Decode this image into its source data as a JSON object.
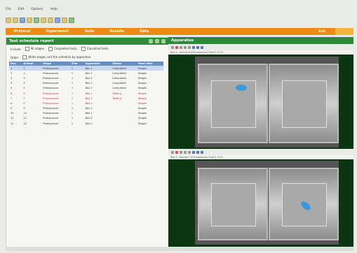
{
  "menu": [
    "File",
    "Edit",
    "Options",
    "Help"
  ],
  "nav": {
    "items": [
      "Protocol",
      "Experiment",
      "Tests",
      "Results",
      "Data"
    ],
    "exit": "Exit"
  },
  "left_panel": {
    "title": "Test schedule report",
    "filter_label": "Include",
    "filter_options": [
      "All stages",
      "Completed tests",
      "Cancelled tests"
    ],
    "order_label": "Order",
    "order_option": "Write stages sort the schedule by apparatus"
  },
  "table": {
    "headers": [
      "Run",
      "Animal",
      "Stage",
      "Trial",
      "Apparatus",
      "Status",
      "Start date"
    ],
    "rows": [
      [
        "1",
        "1",
        "Preexposure",
        "1",
        "Box 1",
        "Completed",
        "Stages"
      ],
      [
        "2",
        "2",
        "Preexposure",
        "1",
        "Box 1",
        "Completed",
        "Stages"
      ],
      [
        "3",
        "3",
        "Preexposure",
        "1",
        "Box 2",
        "Completed",
        "Stages"
      ],
      [
        "4",
        "4",
        "Preexposure",
        "1",
        "Box 2",
        "Completed",
        "Stages"
      ],
      [
        "5",
        "5",
        "Preexposure",
        "1",
        "Box 1",
        "Completed",
        "Stages"
      ],
      [
        "6",
        "6",
        "Preexposure",
        "1",
        "Box 1",
        "Testing",
        "Stages"
      ],
      [
        "7",
        "7",
        "Preexposure",
        "1",
        "Box 2",
        "Testing",
        "Stages"
      ],
      [
        "8",
        "8",
        "Preexposure",
        "1",
        "Box 2",
        "",
        "Stages"
      ],
      [
        "9",
        "9",
        "Preexposure",
        "1",
        "Box 1",
        "",
        "Stages"
      ],
      [
        "10",
        "10",
        "Preexposure",
        "1",
        "Box 1",
        "",
        "Stages"
      ],
      [
        "11",
        "11",
        "Preexposure",
        "1",
        "Box 2",
        "",
        "Stages"
      ],
      [
        "12",
        "12",
        "Preexposure",
        "1",
        "Box 2",
        "",
        "Stages"
      ]
    ],
    "selected_row": 0,
    "warn_rows": [
      5,
      6,
      7
    ]
  },
  "right_panel": {
    "title": "Apparatus",
    "video1_label": "Box 1 - Animal 6 (Pre-exposure) Trial 1: 0:22",
    "video2_label": "Box 2 - Animal 7 (Pre-exposure) Trial 1: 0:21"
  },
  "icons": [
    "save-icon",
    "open-icon",
    "print-icon",
    "play-icon",
    "stop-icon",
    "record-icon",
    "zoom-icon"
  ],
  "colors": {
    "accent": "#ef8a16",
    "panel_header": "#2c8a3a",
    "table_header": "#6a8fc1",
    "video_bg": "#0c3512"
  }
}
